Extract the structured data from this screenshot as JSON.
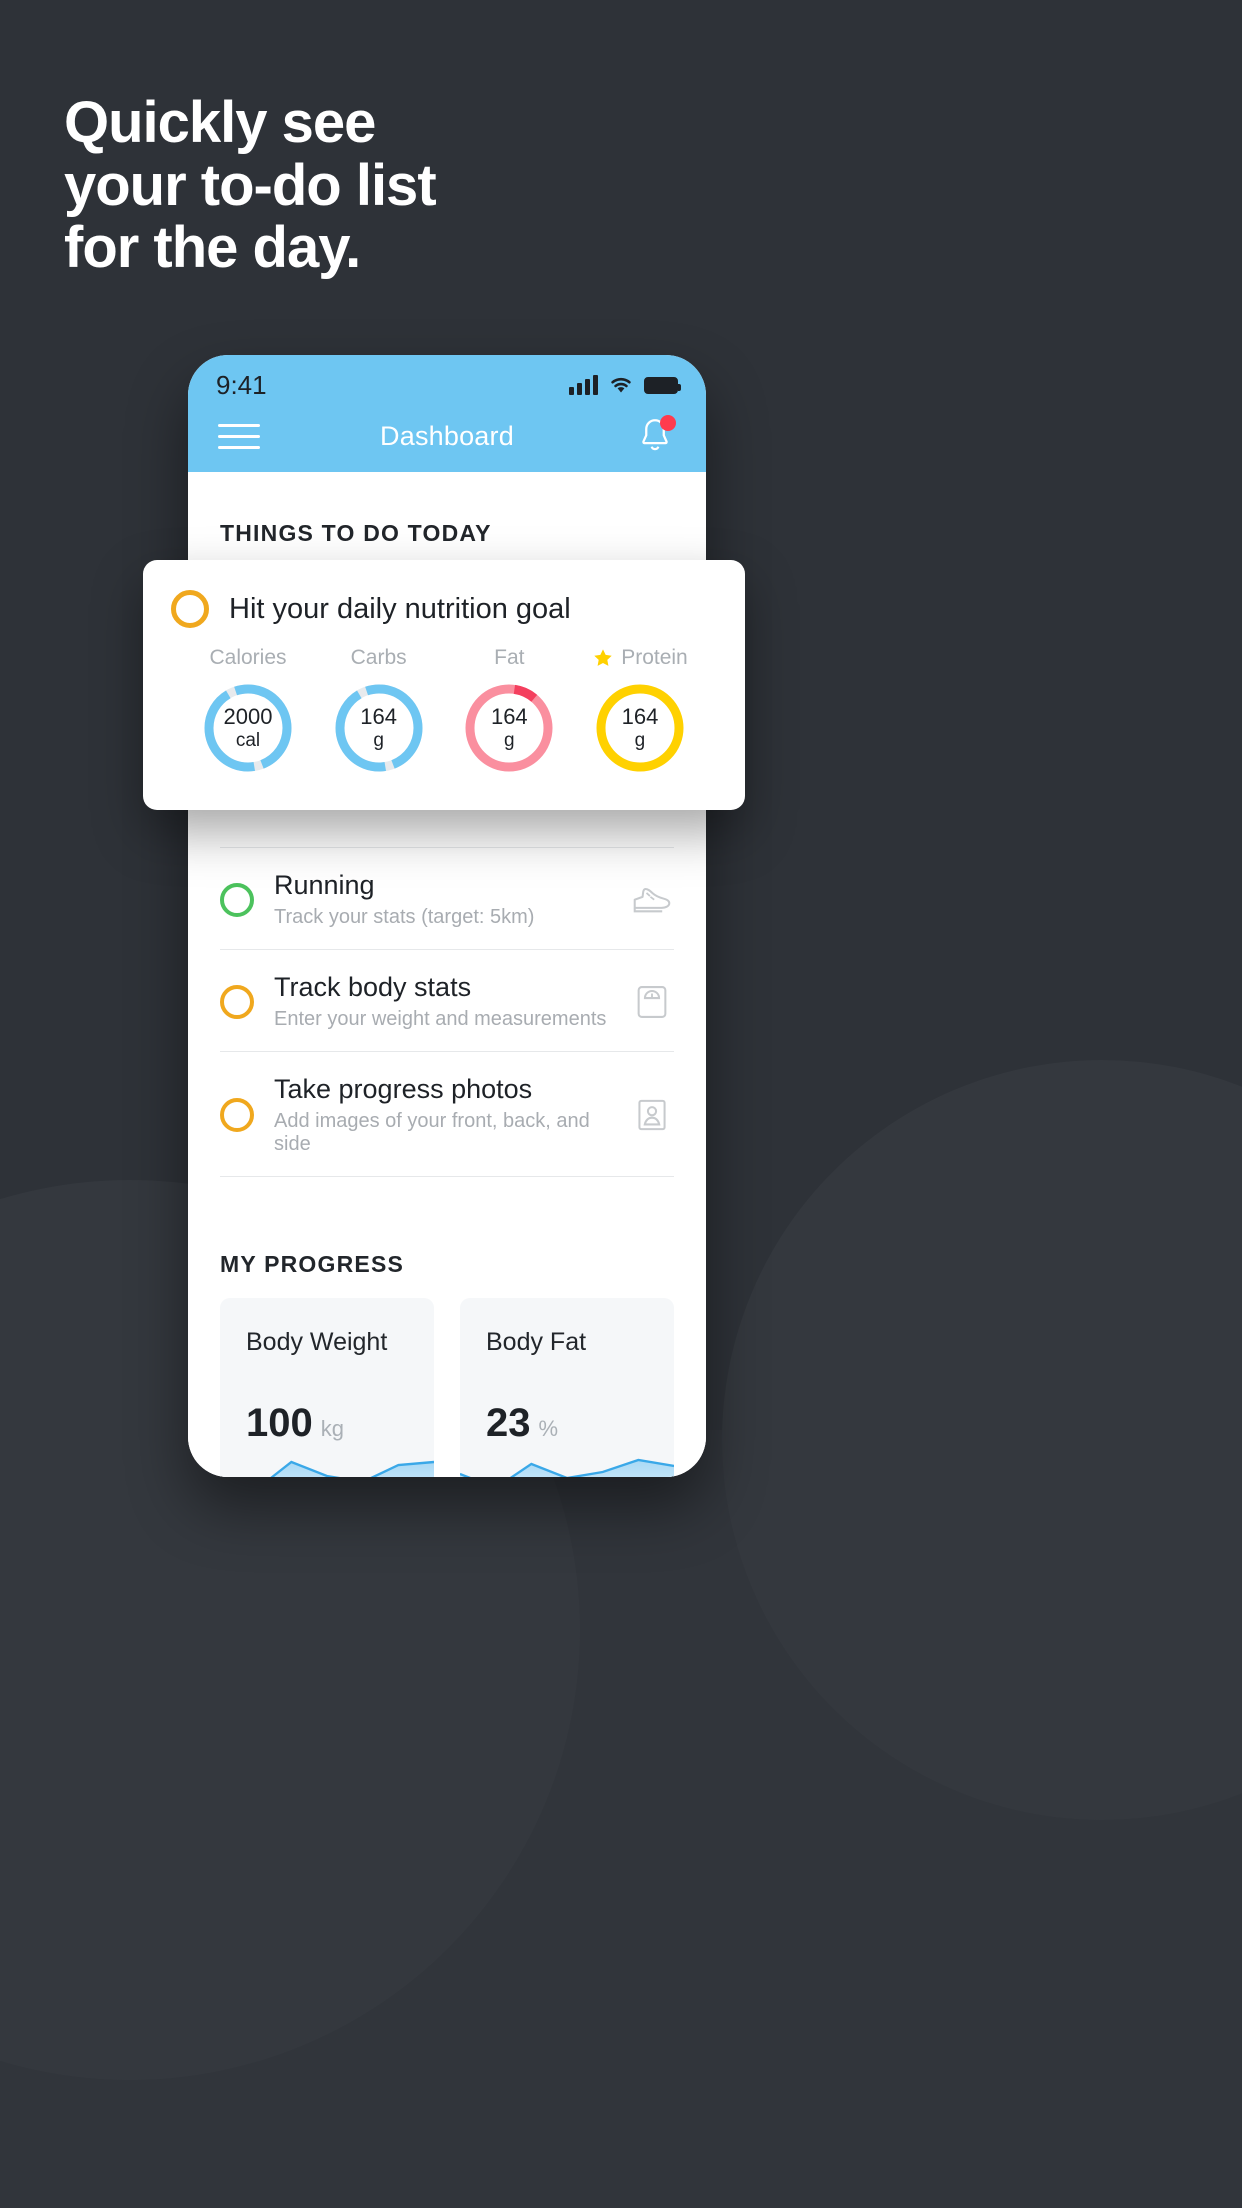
{
  "headline": {
    "line1": "Quickly see",
    "line2": "your to-do list",
    "line3": "for the day."
  },
  "colors": {
    "background": "#2e3238",
    "accent_blue": "#6ec6f2",
    "accent_yellow": "#f0a81e",
    "accent_gold": "#ffd100",
    "accent_green": "#4cc25d",
    "accent_pink": "#fa8f9f",
    "accent_red": "#f43f5e",
    "badge_red": "#ff3b4e",
    "ring_track": "#e7eaed"
  },
  "phone": {
    "status_bar": {
      "time": "9:41",
      "signal_icon": "cellular-signal-icon",
      "wifi_icon": "wifi-icon",
      "battery_icon": "battery-icon"
    },
    "navbar": {
      "menu_icon": "hamburger-menu-icon",
      "title": "Dashboard",
      "notification_icon": "bell-icon",
      "has_badge": true
    },
    "todo_section": {
      "title": "THINGS TO DO TODAY",
      "items": [
        {
          "title": "Running",
          "subtitle": "Track your stats (target: 5km)",
          "check_color": "green",
          "icon": "running-shoe-icon"
        },
        {
          "title": "Track body stats",
          "subtitle": "Enter your weight and measurements",
          "check_color": "yellow",
          "icon": "weight-scale-icon"
        },
        {
          "title": "Take progress photos",
          "subtitle": "Add images of your front, back, and side",
          "check_color": "yellow",
          "icon": "person-photo-icon"
        }
      ]
    },
    "progress_section": {
      "title": "MY PROGRESS",
      "cards": [
        {
          "label": "Body Weight",
          "value": "100",
          "unit": "kg"
        },
        {
          "label": "Body Fat",
          "value": "23",
          "unit": "%"
        }
      ]
    }
  },
  "nutrition_card": {
    "check_icon": "circle-checkbox-icon",
    "title": "Hit your daily nutrition goal",
    "macros": [
      {
        "label": "Calories",
        "value": "2000",
        "unit": "cal",
        "color": "#6ec6f2",
        "percent": 88,
        "starred": false
      },
      {
        "label": "Carbs",
        "value": "164",
        "unit": "g",
        "color": "#6ec6f2",
        "percent": 88,
        "starred": false
      },
      {
        "label": "Fat",
        "value": "164",
        "unit": "g",
        "color": "#fa8f9f",
        "percent": 92,
        "starred": false
      },
      {
        "label": "Protein",
        "value": "164",
        "unit": "g",
        "color": "#ffd100",
        "percent": 100,
        "starred": true,
        "star_icon": "star-icon"
      }
    ]
  },
  "chart_data": [
    {
      "type": "area",
      "title": "Body Weight",
      "ylabel": "kg",
      "x": [
        0,
        1,
        2,
        3,
        4,
        5,
        6
      ],
      "values": [
        52,
        40,
        72,
        58,
        50,
        70,
        74
      ],
      "line_color": "#3aa8e8",
      "grid": false
    },
    {
      "type": "area",
      "title": "Body Fat",
      "ylabel": "%",
      "x": [
        0,
        1,
        2,
        3,
        4,
        5,
        6
      ],
      "values": [
        58,
        44,
        72,
        54,
        62,
        76,
        70
      ],
      "line_color": "#3aa8e8",
      "grid": false
    }
  ]
}
